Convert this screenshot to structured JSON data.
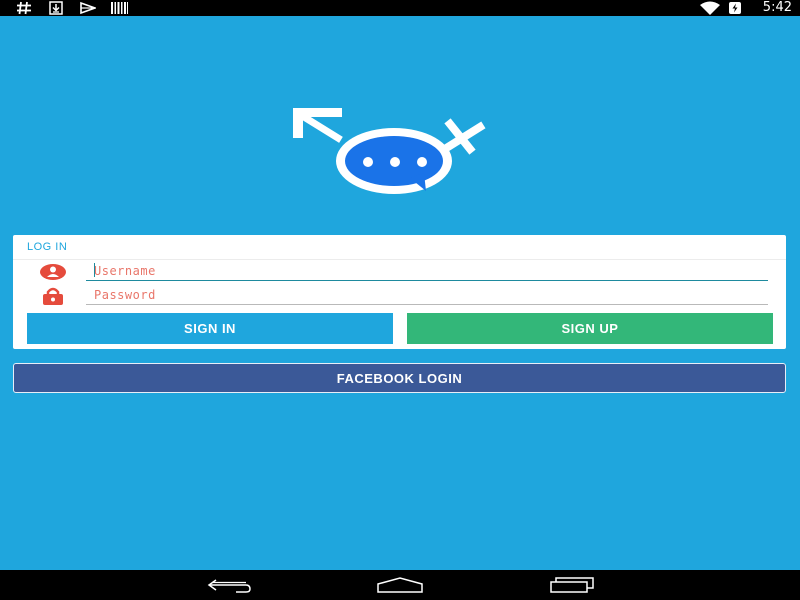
{
  "status_bar": {
    "time": "5:42",
    "left_icons": [
      "hash-icon",
      "download-icon",
      "play-store-icon",
      "barcode-icon"
    ],
    "right_icons": [
      "wifi-icon",
      "battery-charging-icon"
    ]
  },
  "logo": {
    "icon": "gender-chat-logo-icon",
    "colors": {
      "bubble": "#1a73e8",
      "symbol": "#ffffff"
    }
  },
  "login": {
    "title": "LOG IN",
    "username": {
      "placeholder": "Username",
      "value": "",
      "icon": "user-icon"
    },
    "password": {
      "placeholder": "Password",
      "value": "",
      "icon": "lock-icon"
    },
    "sign_in_label": "SIGN IN",
    "sign_up_label": "SIGN UP"
  },
  "facebook_label": "FACEBOOK LOGIN",
  "nav_bar": {
    "buttons": [
      "back-icon",
      "home-icon",
      "recents-icon"
    ]
  },
  "colors": {
    "background": "#1fa6dd",
    "sign_in": "#1fa6dd",
    "sign_up": "#33b779",
    "facebook": "#3b5998",
    "field_icon": "#e54b3c",
    "placeholder": "#e9766a"
  }
}
